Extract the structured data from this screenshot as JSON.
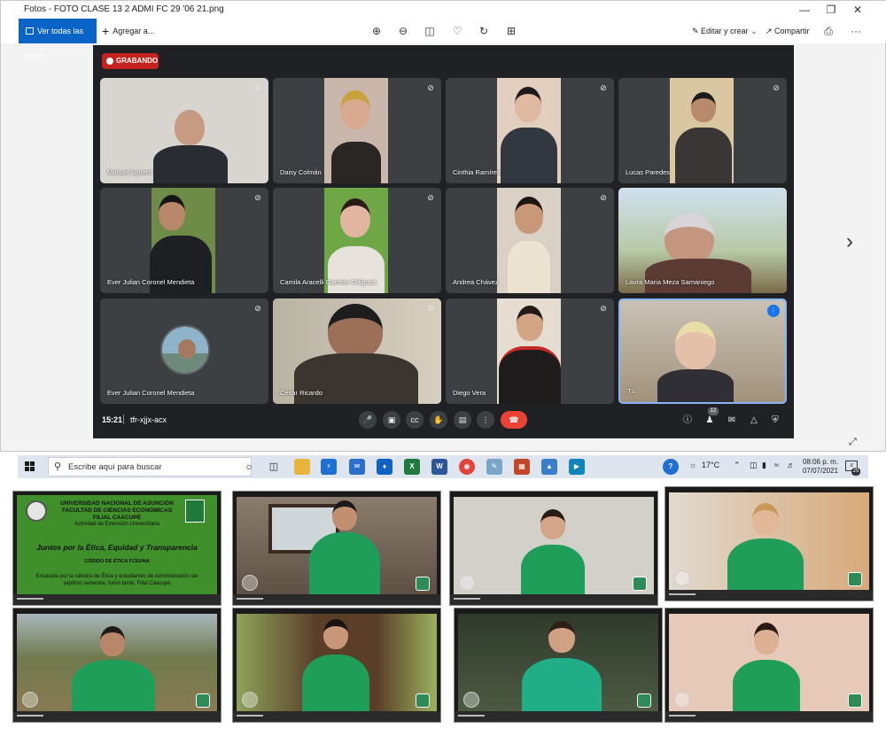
{
  "window": {
    "title": "Fotos - FOTO CLASE 13  2 ADMI FC  29 '06 21.png",
    "min_icon": "minimize-icon",
    "max_icon": "maximize-icon",
    "close_icon": "close-icon"
  },
  "toolbar": {
    "view_all": "Ver todas las fotos",
    "add": "Agregar a...",
    "edit_create": "Editar y crear",
    "share": "Compartir"
  },
  "meet": {
    "recording_label": "GRABANDO",
    "time": "15:21",
    "meeting_code": "tfr-xjjx-acx",
    "people_count": "12",
    "participants": [
      {
        "name": "Manuel Aguero"
      },
      {
        "name": "Daisy Colmán"
      },
      {
        "name": "Cinthia Ramírez"
      },
      {
        "name": "Lucas Paredes"
      },
      {
        "name": "Ever Julian Coronel Mendieta"
      },
      {
        "name": "Camila Aracelli Garcete Ortigoza"
      },
      {
        "name": "Andrea Chávez"
      },
      {
        "name": "Laura Maria Meza Samaniego"
      },
      {
        "name": "Ever Julian Coronel Mendieta"
      },
      {
        "name": "César Ricardo"
      },
      {
        "name": "Diego Vera"
      },
      {
        "name": "Tú"
      }
    ]
  },
  "taskbar": {
    "search_placeholder": "Escribe aquí para buscar",
    "weather": "17°C",
    "time": "08:06 p. m.",
    "date": "07/07/2021",
    "notification_count": "25"
  },
  "slide": {
    "line1": "UNIVERSIDAD NACIONAL DE ASUNCIÓN",
    "line2": "FACULTAD DE CIENCIAS ECONOMICAS",
    "line3": "FILIAL CAACUPÉ",
    "line4": "Actividad de Extensión Universitaria",
    "heading": "Juntos por la Ética, Equidad y Transparencia",
    "subheading": "CÓDIDO DE ÉTICA FCEUNA",
    "body": "Encarada por la cátedra de Ética y estudiantes de Administración del séptimo semestre, turno tarde. Filial Caacupé"
  },
  "colors": {
    "meet_bg": "#202124",
    "tile_bg": "#3c4043",
    "record_red": "#c5221f",
    "end_call_red": "#ea4335",
    "photos_blue": "#0a64c8",
    "shirt_green": "#1f9e5a"
  }
}
